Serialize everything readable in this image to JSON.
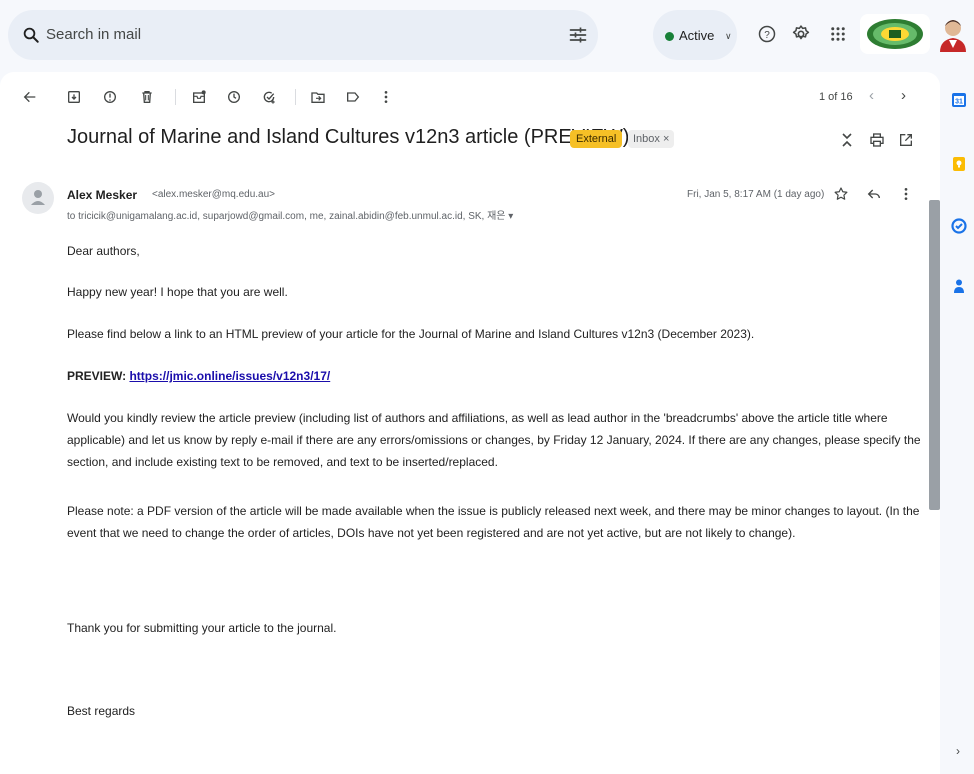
{
  "search": {
    "placeholder": "Search in mail"
  },
  "status": {
    "label": "Active",
    "color": "#188038"
  },
  "toolbar": {
    "pager": "1 of 16",
    "icons": [
      "back-arrow-icon",
      "archive-icon",
      "report-spam-icon",
      "delete-icon",
      "mark-unread-icon",
      "snooze-icon",
      "add-task-icon",
      "move-to-icon",
      "label-icon",
      "more-vert-icon"
    ]
  },
  "email": {
    "subject": "Journal of Marine and Island Cultures v12n3 article (PREVIEW)",
    "labels": {
      "external": "External",
      "inbox": "Inbox",
      "inbox_remove": "×"
    },
    "sender_name": "Alex Mesker",
    "sender_email": "<alex.mesker@mq.edu.au>",
    "recipients": "to tricicik@unigamalang.ac.id, suparjowd@gmail.com, me, zainal.abidin@feb.unmul.ac.id, SK, 재은",
    "date": "Fri, Jan 5, 8:17 AM (1 day ago)",
    "body": {
      "greeting": "Dear authors,",
      "p1": "Happy new year! I hope that you are well.",
      "p2": "Please find below a link to an HTML preview of your article for the Journal of Marine and Island Cultures v12n3 (December 2023).",
      "preview_label": "PREVIEW:",
      "preview_link": "https://jmic.online/issues/v12n3/17/",
      "p3": "Would you kindly review the article preview (including list of authors and affiliations, as well as lead author in the 'breadcrumbs' above the article title where applicable) and let us know by reply e-mail if there are any errors/omissions or changes, by Friday 12 January, 2024. If there are any changes, please specify the section, and include existing text to be removed, and text to be inserted/replaced.",
      "p4": "Please note: a PDF version of the article will be made available when the issue is publicly released next week, and there may be minor changes to layout. (In the event that we need to change the order of articles, DOIs have not yet been registered and are not yet active, but are not likely to change).",
      "p5": "Thank you for submitting your article to the journal.",
      "closing": "Best regards"
    }
  },
  "colors": {
    "background": "#f6f8fc",
    "search_bg": "#e9eef6",
    "external_badge": "#f6c026",
    "link": "#1a0dab"
  },
  "rail": {
    "calendar_day": "31"
  }
}
